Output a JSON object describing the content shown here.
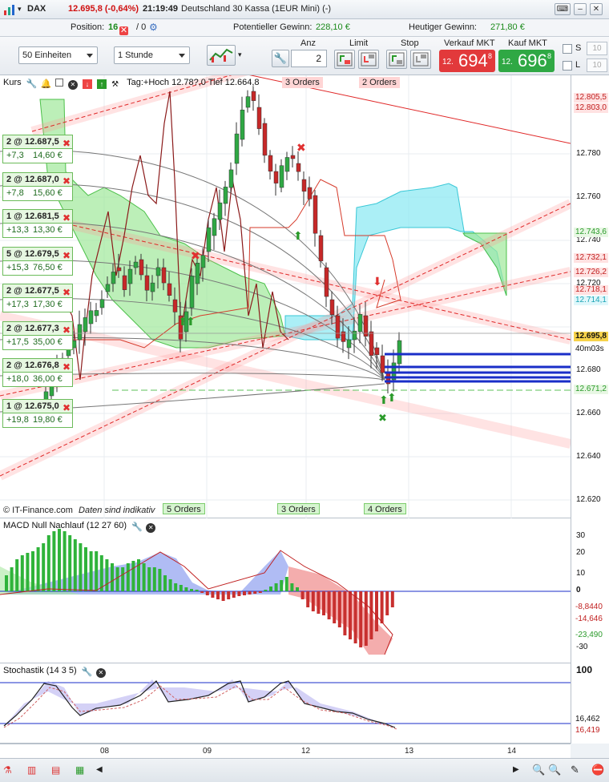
{
  "titlebar": {
    "symbol": "DAX",
    "price": "12.695,8 (-0,64%)",
    "time": "21:19:49",
    "instrument": "Deutschland 30 Kassa (1EUR Mini) (-)"
  },
  "posbar": {
    "position_label": "Position:",
    "position_value": "16",
    "orders_value": "/ 0",
    "potential_label": "Potentieller Gewinn:",
    "potential_value": "228,10 €",
    "today_label": "Heutiger Gewinn:",
    "today_value": "271,80 €"
  },
  "toolbar": {
    "units": "50 Einheiten",
    "timeframe": "1 Stunde",
    "anz_label": "Anz",
    "anz_value": "2",
    "limit_label": "Limit",
    "stop_label": "Stop",
    "sell_label": "Verkauf MKT",
    "sell_prefix": "12.",
    "sell_big": "694",
    "sell_frac": "8",
    "buy_label": "Kauf MKT",
    "buy_prefix": "12.",
    "buy_big": "696",
    "buy_frac": "8",
    "s_label": "S",
    "l_label": "L",
    "s_value": "10",
    "l_value": "10",
    "colors": {
      "sell": "#e2393b",
      "buy": "#2fa844"
    }
  },
  "main_pane": {
    "header": "Kurs",
    "overlay_text": "Tag:+Hoch 12.78?,0 Tief 12.664,8",
    "footer_source": "© IT-Finance.com",
    "footer_note": "Daten sind indikativ",
    "top_orders": [
      "3 Orders",
      "2 Orders"
    ],
    "bottom_orders": [
      "5 Orders",
      "3 Orders",
      "4 Orders"
    ],
    "axis_ticks": [
      "12.780",
      "12.760",
      "12.740",
      "12.720",
      "12.680",
      "12.660",
      "12.640",
      "12.620"
    ],
    "axis_tags": [
      {
        "text": "12.805,5",
        "color": "#c02020",
        "bg": "#ffe2e2"
      },
      {
        "text": "12.803,0",
        "color": "#c02020",
        "bg": "#ffe2e2"
      },
      {
        "text": "12.743,6",
        "color": "#2a9a2a",
        "bg": "#e8f7e4"
      },
      {
        "text": "12.732,1",
        "color": "#c02020",
        "bg": "#ffe2e2"
      },
      {
        "text": "12.726,2",
        "color": "#c02020",
        "bg": "#ffe2e2"
      },
      {
        "text": "12.718,1",
        "color": "#c02020",
        "bg": "#ffe2e2"
      },
      {
        "text": "12.714,1",
        "color": "#1ba4b5",
        "bg": "#dff7fb"
      },
      {
        "text": "12.695,8",
        "color": "#111111",
        "bg": "#f6d24a"
      },
      {
        "text": "40m03s",
        "color": "#111111",
        "bg": "#ffffff"
      },
      {
        "text": "12.671,2",
        "color": "#2a9a2a",
        "bg": "#e8f7e4"
      }
    ],
    "orders": [
      {
        "qty": "2 @ 12.687,5",
        "pts": "+7,3",
        "eur": "14,60 €"
      },
      {
        "qty": "2 @ 12.687,0",
        "pts": "+7,8",
        "eur": "15,60 €"
      },
      {
        "qty": "1 @ 12.681,5",
        "pts": "+13,3",
        "eur": "13,30 €"
      },
      {
        "qty": "5 @ 12.679,5",
        "pts": "+15,3",
        "eur": "76,50 €"
      },
      {
        "qty": "2 @ 12.677,5",
        "pts": "+17,3",
        "eur": "17,30 €"
      },
      {
        "qty": "2 @ 12.677,3",
        "pts": "+17,5",
        "eur": "35,00 €"
      },
      {
        "qty": "2 @ 12.676,8",
        "pts": "+18,0",
        "eur": "36,00 €"
      },
      {
        "qty": "1 @ 12.675,0",
        "pts": "+19,8",
        "eur": "19,80 €"
      }
    ]
  },
  "macd_pane": {
    "header": "MACD Null Nachlauf (12 27 60)",
    "axis_ticks": [
      "30",
      "20",
      "10",
      "0",
      "-30"
    ],
    "axis_tags": [
      {
        "text": "-8,8440",
        "color": "#c02020"
      },
      {
        "text": "-14,646",
        "color": "#c02020"
      },
      {
        "text": "-23,490",
        "color": "#2a9a2a"
      }
    ]
  },
  "stoch_pane": {
    "header": "Stochastik (14 3 5)",
    "axis_ticks": [
      "100"
    ],
    "axis_tags": [
      {
        "text": "16,462",
        "color": "#111111"
      },
      {
        "text": "16,419",
        "color": "#c02020"
      }
    ]
  },
  "xaxis": {
    "labels": [
      "08",
      "09",
      "12",
      "13",
      "14"
    ]
  }
}
